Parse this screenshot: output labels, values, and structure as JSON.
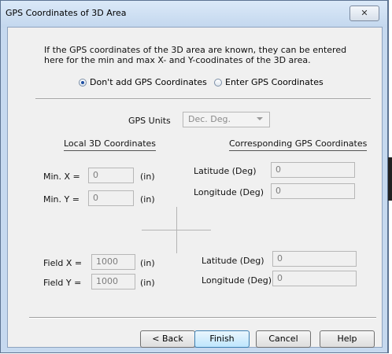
{
  "window": {
    "title": "GPS Coordinates of 3D Area",
    "close_glyph": "✕"
  },
  "intro_text": "If the GPS coordinates of the 3D area are known, they can be entered here for the min and max X- and Y-coodinates of the 3D area.",
  "radios": {
    "dont_add": {
      "label": "Don't add GPS Coordinates",
      "selected": true
    },
    "enter": {
      "label": "Enter GPS Coordinates",
      "selected": false
    }
  },
  "gps_units": {
    "label": "GPS Units",
    "value": "Dec. Deg."
  },
  "local_header": "Local 3D Coordinates",
  "gps_header": "Corresponding GPS Coordinates",
  "min_x": {
    "label": "Min. X =",
    "value": "0",
    "unit": "(in)"
  },
  "min_y": {
    "label": "Min. Y =",
    "value": "0",
    "unit": "(in)"
  },
  "field_x": {
    "label": "Field X =",
    "value": "1000",
    "unit": "(in)"
  },
  "field_y": {
    "label": "Field Y =",
    "value": "1000",
    "unit": "(in)"
  },
  "gps_min": {
    "lat_label": "Latitude (Deg)",
    "lat_value": "0",
    "lon_label": "Longitude (Deg)",
    "lon_value": "0"
  },
  "gps_field": {
    "lat_label": "Latitude (Deg)",
    "lat_value": "0",
    "lon_label": "Longitude (Deg)",
    "lon_value": "0"
  },
  "buttons": {
    "back": "< Back",
    "finish": "Finish",
    "cancel": "Cancel",
    "help": "Help"
  }
}
